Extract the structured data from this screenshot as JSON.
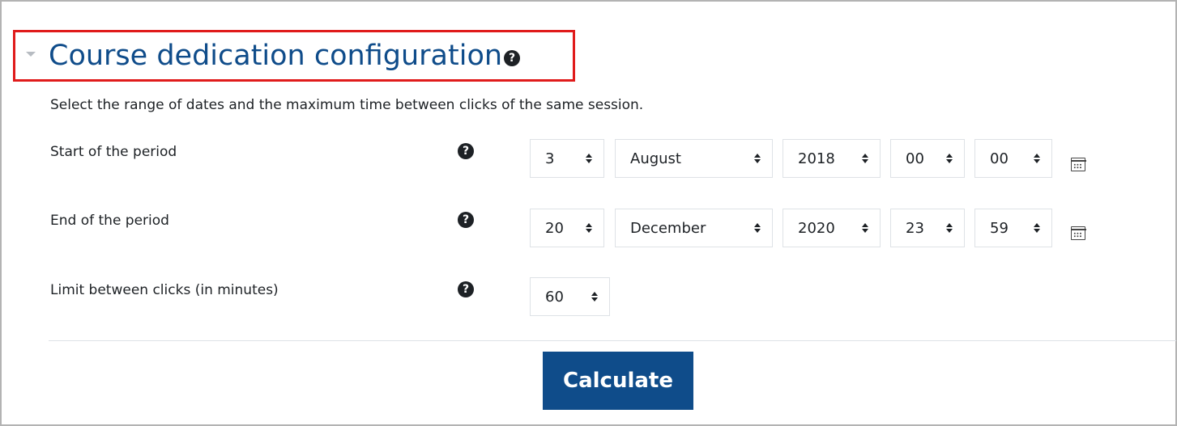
{
  "section": {
    "title": "Course dedication configuration",
    "help_glyph": "?",
    "description": "Select the range of dates and the maximum time between clicks of the same session."
  },
  "start": {
    "label": "Start of the period",
    "day": "3",
    "month": "August",
    "year": "2018",
    "hour": "00",
    "minute": "00"
  },
  "end": {
    "label": "End of the period",
    "day": "20",
    "month": "December",
    "year": "2020",
    "hour": "23",
    "minute": "59"
  },
  "limit": {
    "label": "Limit between clicks (in minutes)",
    "value": "60"
  },
  "actions": {
    "calculate_label": "Calculate"
  },
  "colors": {
    "accent": "#0f4c8a",
    "highlight_border": "#e01b1b",
    "text": "#1d2125"
  }
}
